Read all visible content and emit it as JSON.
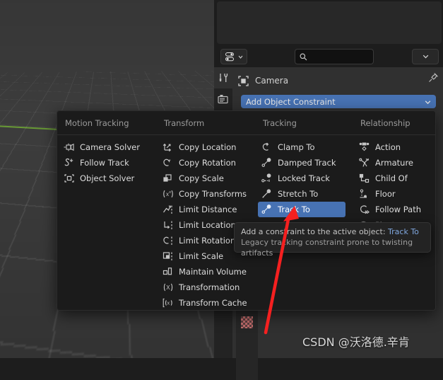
{
  "viewport": {
    "name": "3d-viewport",
    "grid_color": "#555555",
    "axis_y_color": "#6a9f35",
    "background": "#3d3d3d"
  },
  "properties": {
    "search_placeholder": "",
    "search_value": "",
    "breadcrumb_object": "Camera",
    "add_constraint_label": "Add Object Constraint",
    "accent_color": "#4772b3",
    "tabs": [
      {
        "name": "tool-tab",
        "icon": "tool-icon"
      },
      {
        "name": "render-tab",
        "icon": "camera-back-icon"
      }
    ]
  },
  "menu": {
    "title": "add-object-constraint-menu",
    "columns": [
      {
        "header": "Motion Tracking",
        "items": [
          {
            "label": "Camera Solver",
            "icon": "camera-solver-icon",
            "selected": false
          },
          {
            "label": "Follow Track",
            "icon": "follow-track-icon",
            "selected": false
          },
          {
            "label": "Object Solver",
            "icon": "object-solver-icon",
            "selected": false
          }
        ]
      },
      {
        "header": "Transform",
        "items": [
          {
            "label": "Copy Location",
            "icon": "copy-location-icon",
            "selected": false
          },
          {
            "label": "Copy Rotation",
            "icon": "copy-rotation-icon",
            "selected": false
          },
          {
            "label": "Copy Scale",
            "icon": "copy-scale-icon",
            "selected": false
          },
          {
            "label": "Copy Transforms",
            "icon": "copy-transforms-icon",
            "selected": false
          },
          {
            "label": "Limit Distance",
            "icon": "limit-distance-icon",
            "selected": false
          },
          {
            "label": "Limit Location",
            "icon": "limit-location-icon",
            "selected": false
          },
          {
            "label": "Limit Rotation",
            "icon": "limit-rotation-icon",
            "selected": false
          },
          {
            "label": "Limit Scale",
            "icon": "limit-scale-icon",
            "selected": false
          },
          {
            "label": "Maintain Volume",
            "icon": "maintain-volume-icon",
            "selected": false
          },
          {
            "label": "Transformation",
            "icon": "transformation-icon",
            "selected": false
          },
          {
            "label": "Transform Cache",
            "icon": "transform-cache-icon",
            "selected": false
          }
        ]
      },
      {
        "header": "Tracking",
        "items": [
          {
            "label": "Clamp To",
            "icon": "clamp-to-icon",
            "selected": false
          },
          {
            "label": "Damped Track",
            "icon": "damped-track-icon",
            "selected": false
          },
          {
            "label": "Locked Track",
            "icon": "locked-track-icon",
            "selected": false
          },
          {
            "label": "Stretch To",
            "icon": "stretch-to-icon",
            "selected": false
          },
          {
            "label": "Track To",
            "icon": "track-to-icon",
            "selected": true
          }
        ]
      },
      {
        "header": "Relationship",
        "items": [
          {
            "label": "Action",
            "icon": "action-icon",
            "selected": false
          },
          {
            "label": "Armature",
            "icon": "armature-icon",
            "selected": false
          },
          {
            "label": "Child Of",
            "icon": "child-of-icon",
            "selected": false
          },
          {
            "label": "Floor",
            "icon": "floor-icon",
            "selected": false
          },
          {
            "label": "Follow Path",
            "icon": "follow-path-icon",
            "selected": false
          },
          {
            "label": "Pivot",
            "icon": "pivot-icon",
            "selected": false,
            "clipped": true
          }
        ]
      }
    ]
  },
  "tooltip": {
    "line1_prefix": "Add a constraint to the active object: ",
    "line1_value": "Track To",
    "line2": "Legacy tracking constraint prone to twisting artifacts"
  },
  "annotation": {
    "arrow_color": "#f52020",
    "points_to": "Track To"
  },
  "watermark": {
    "text": "CSDN @沃洛德.辛肯"
  }
}
